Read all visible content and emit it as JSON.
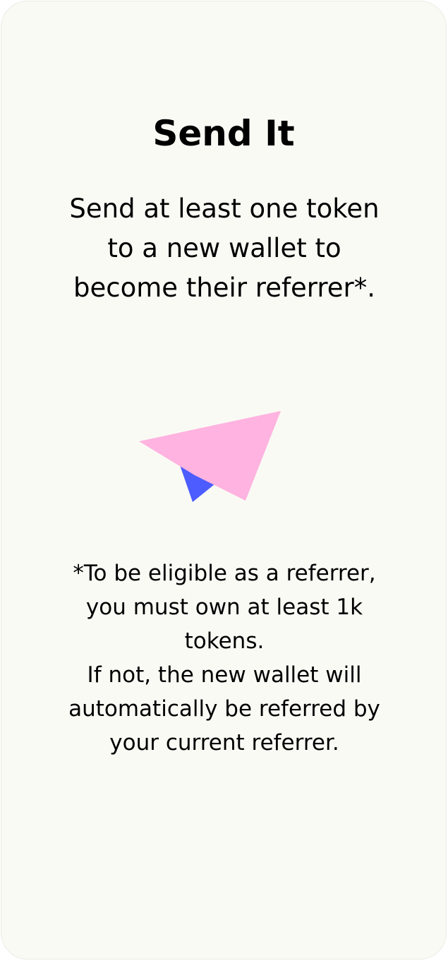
{
  "card": {
    "title": "Send It",
    "description": "Send at least one token to a new wallet to become their referrer*.",
    "footnote_line1": "*To be eligible as a referrer, you must own at least 1k tokens.",
    "footnote_line2": "If not, the new wallet will automatically be referred by your current referrer."
  },
  "illustration": {
    "icon": "paper-plane-icon",
    "colors": {
      "wing": "#ffb3e0",
      "fold": "#4d5cff"
    }
  }
}
